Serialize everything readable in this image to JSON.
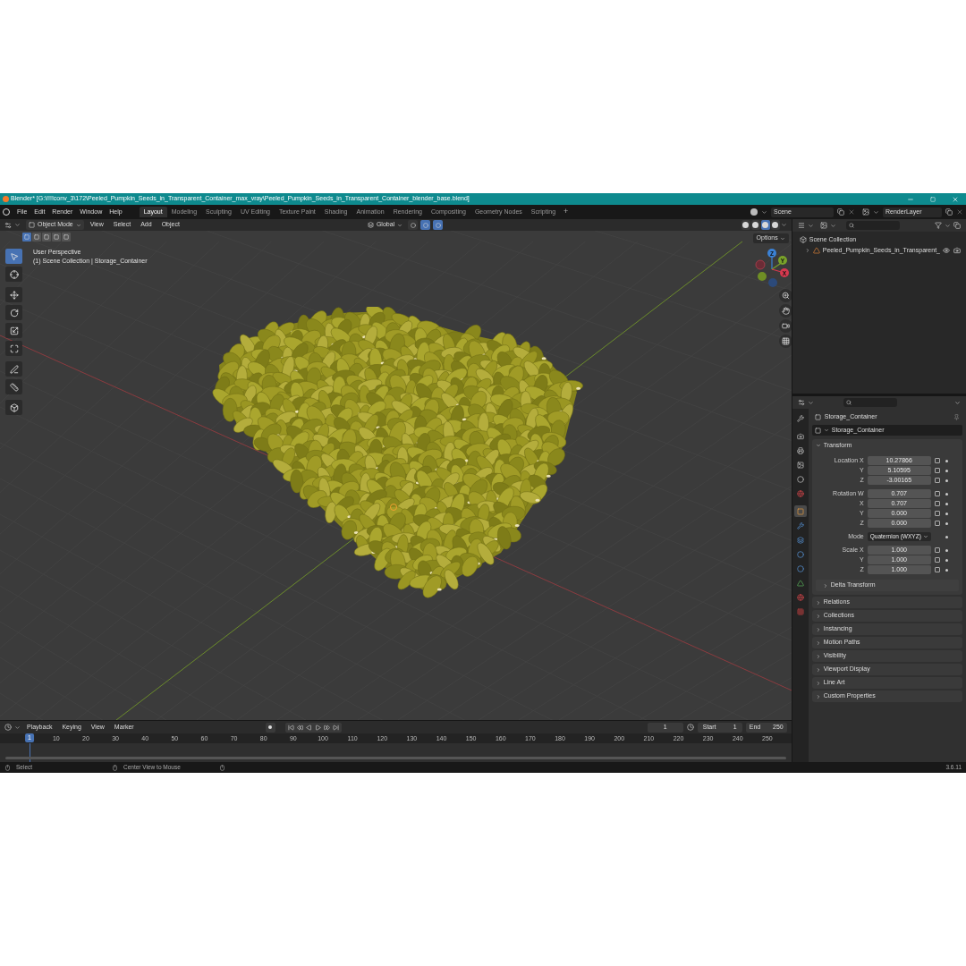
{
  "window": {
    "title": "Blender* [G:\\!!!!conv_3\\172\\Peeled_Pumpkin_Seeds_in_Transparent_Container_max_vray\\Peeled_Pumpkin_Seeds_in_Transparent_Container_blender_base.blend]"
  },
  "menu": [
    "File",
    "Edit",
    "Render",
    "Window",
    "Help"
  ],
  "workspaces": [
    {
      "label": "Layout",
      "selected": true
    },
    {
      "label": "Modeling",
      "selected": false
    },
    {
      "label": "Sculpting",
      "selected": false
    },
    {
      "label": "UV Editing",
      "selected": false
    },
    {
      "label": "Texture Paint",
      "selected": false
    },
    {
      "label": "Shading",
      "selected": false
    },
    {
      "label": "Animation",
      "selected": false
    },
    {
      "label": "Rendering",
      "selected": false
    },
    {
      "label": "Compositing",
      "selected": false
    },
    {
      "label": "Geometry Nodes",
      "selected": false
    },
    {
      "label": "Scripting",
      "selected": false
    }
  ],
  "add_workspace": "+",
  "scene": "Scene",
  "view_layer": "RenderLayer",
  "viewport": {
    "mode": "Object Mode",
    "menus": [
      "View",
      "Select",
      "Add",
      "Object"
    ],
    "orientation": "Global",
    "options": "Options",
    "view_name": "User Perspective",
    "context": "(1) Scene Collection | Storage_Container",
    "select_modes": [
      {
        "selected": true
      },
      {
        "selected": false
      },
      {
        "selected": false
      },
      {
        "selected": false
      },
      {
        "selected": false
      }
    ],
    "tools": [
      {
        "selected": true
      },
      {
        "selected": false
      },
      {
        "selected": false
      },
      {
        "selected": false
      },
      {
        "selected": false
      },
      {
        "selected": false
      },
      {
        "selected": false
      },
      {
        "selected": false
      },
      {
        "selected": false
      }
    ],
    "toggles": [
      {
        "on": false
      },
      {
        "on": true
      },
      {
        "on": true
      }
    ],
    "shading": [
      {
        "selected": false
      },
      {
        "selected": false
      },
      {
        "selected": true
      },
      {
        "selected": false
      }
    ],
    "gizmo_axes": [
      "X",
      "Y",
      "Z"
    ]
  },
  "outliner": {
    "items": [
      {
        "label": "Scene Collection",
        "children": [
          {
            "label": "Peeled_Pumpkin_Seeds_in_Transparent_",
            "expanded": false
          }
        ]
      }
    ]
  },
  "properties": {
    "tabs": [
      {
        "selected": false
      },
      {
        "selected": false
      },
      {
        "selected": false
      },
      {
        "selected": false
      },
      {
        "selected": false
      },
      {
        "selected": false
      },
      {
        "selected": true
      },
      {
        "selected": false
      },
      {
        "selected": false
      },
      {
        "selected": false
      },
      {
        "selected": false
      },
      {
        "selected": false
      },
      {
        "selected": false
      },
      {
        "selected": false
      }
    ],
    "object": "Storage_Container",
    "datablock": "Storage_Container",
    "transform": {
      "label": "Transform",
      "expanded": true,
      "groups": [
        [
          {
            "label": "Location X",
            "value": "10.27866",
            "kind": "number"
          },
          {
            "label": "Y",
            "value": "5.10595",
            "kind": "number"
          },
          {
            "label": "Z",
            "value": "-3.00165",
            "kind": "number"
          }
        ],
        [
          {
            "label": "Rotation W",
            "value": "0.707",
            "kind": "number"
          },
          {
            "label": "X",
            "value": "0.707",
            "kind": "number"
          },
          {
            "label": "Y",
            "value": "0.000",
            "kind": "number"
          },
          {
            "label": "Z",
            "value": "0.000",
            "kind": "number"
          }
        ],
        [
          {
            "label": "Mode",
            "value": "Quaternion (WXYZ)",
            "kind": "dropdown"
          }
        ],
        [
          {
            "label": "Scale X",
            "value": "1.000",
            "kind": "number"
          },
          {
            "label": "Y",
            "value": "1.000",
            "kind": "number"
          },
          {
            "label": "Z",
            "value": "1.000",
            "kind": "number"
          }
        ]
      ],
      "sub_panels": [
        {
          "label": "Delta Transform",
          "expanded": false
        }
      ]
    },
    "panels": [
      {
        "label": "Relations",
        "expanded": false
      },
      {
        "label": "Collections",
        "expanded": false
      },
      {
        "label": "Instancing",
        "expanded": false
      },
      {
        "label": "Motion Paths",
        "expanded": false
      },
      {
        "label": "Visibility",
        "expanded": false
      },
      {
        "label": "Viewport Display",
        "expanded": false
      },
      {
        "label": "Line Art",
        "expanded": false
      },
      {
        "label": "Custom Properties",
        "expanded": false
      }
    ]
  },
  "timeline": {
    "menus": [
      "Playback",
      "Keying",
      "View",
      "Marker"
    ],
    "current_frame": "1",
    "start_label": "Start",
    "start": "1",
    "end_label": "End",
    "end": "250",
    "playhead": "1",
    "ruler": [
      "10",
      "20",
      "30",
      "40",
      "50",
      "60",
      "70",
      "80",
      "90",
      "100",
      "110",
      "120",
      "130",
      "140",
      "150",
      "160",
      "170",
      "180",
      "190",
      "200",
      "210",
      "220",
      "230",
      "240",
      "250"
    ]
  },
  "status_bar": {
    "hints": [
      "Select",
      "Center View to Mouse"
    ],
    "version": "3.6.11"
  }
}
